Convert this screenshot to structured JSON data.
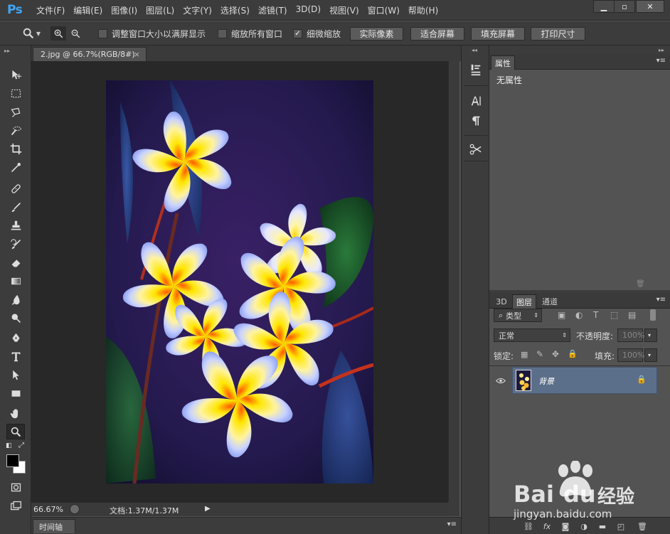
{
  "app": {
    "logo": "Ps"
  },
  "menu": [
    "文件(F)",
    "编辑(E)",
    "图像(I)",
    "图层(L)",
    "文字(Y)",
    "选择(S)",
    "滤镜(T)",
    "3D(D)",
    "视图(V)",
    "窗口(W)",
    "帮助(H)"
  ],
  "window_controls": {
    "minimize": "▁",
    "restore": "▫",
    "close": "✕"
  },
  "options": {
    "resize_windows": {
      "label": "调整窗口大小以满屏显示",
      "checked": false
    },
    "zoom_all": {
      "label": "缩放所有窗口",
      "checked": false
    },
    "scrubby_zoom": {
      "label": "细微缩放",
      "checked": true
    },
    "buttons": {
      "actual_pixels": "实际像素",
      "fit_screen": "适合屏幕",
      "fill_screen": "填充屏幕",
      "print_size": "打印尺寸"
    }
  },
  "document": {
    "tab_title": "2.jpg @ 66.7%(RGB/8#)",
    "close": "×"
  },
  "status": {
    "zoom": "66.67%",
    "doc_size": "文档:1.37M/1.37M",
    "arrow": "▶"
  },
  "timeline": {
    "label": "时间轴"
  },
  "properties_panel": {
    "tab": "属性",
    "content": "无属性"
  },
  "layers_panel": {
    "tabs": [
      "3D",
      "图层",
      "通道"
    ],
    "active_tab": "图层",
    "filter_kind": "类型",
    "blend_mode": "正常",
    "opacity_label": "不透明度:",
    "opacity_value": "100%",
    "lock_label": "锁定:",
    "fill_label": "填充:",
    "fill_value": "100%",
    "layers": [
      {
        "name": "背景",
        "visible": true,
        "locked": true
      }
    ]
  },
  "watermark": {
    "brand": "Bai",
    "brand2": "du",
    "suffix": "经验",
    "url": "jingyan.baidu.com"
  },
  "colors": {
    "ps_blue": "#3fa6f5",
    "panel_bg": "#535353",
    "chrome": "#3c3c3c",
    "selected_layer": "#5c6f8a"
  }
}
